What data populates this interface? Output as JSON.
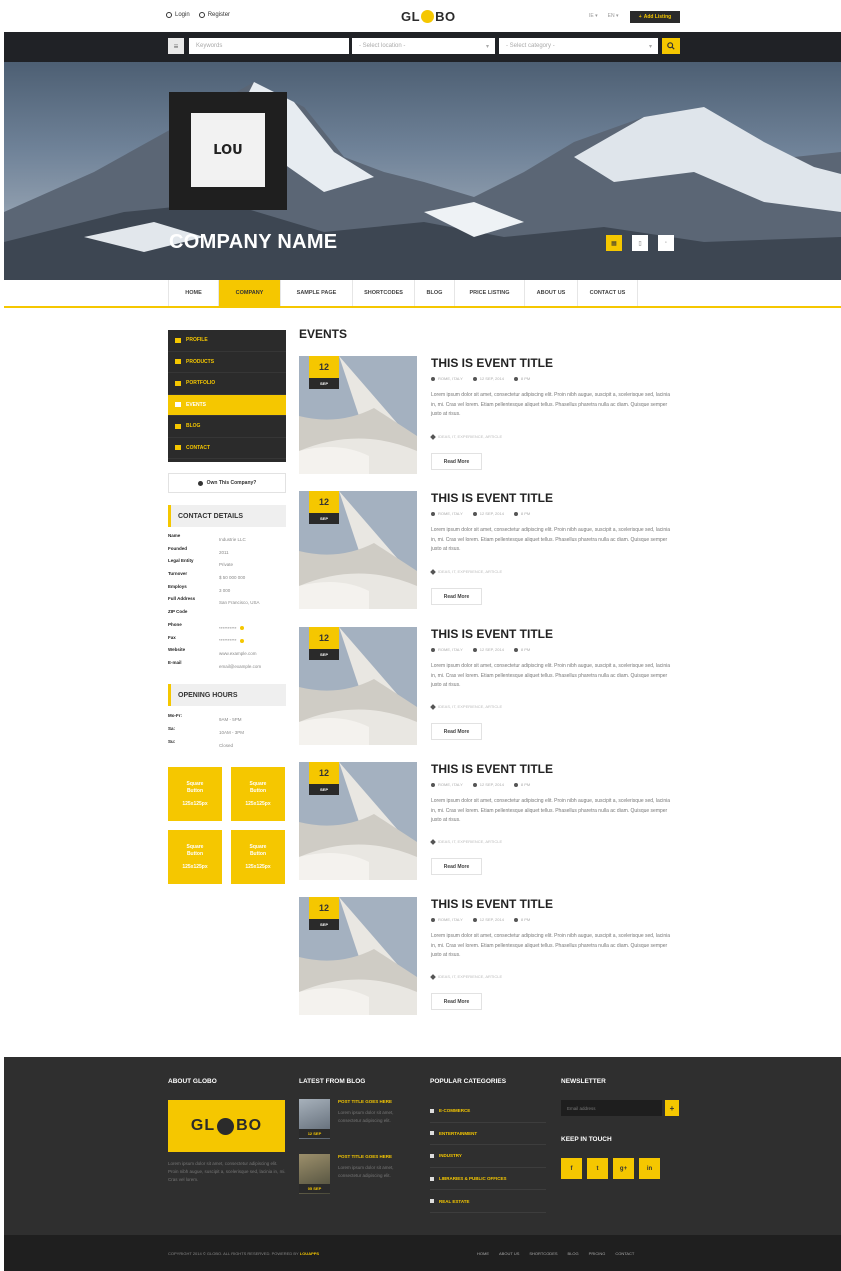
{
  "topbar": {
    "login": "Login",
    "register": "Register",
    "logo_left": "GL",
    "logo_right": "BO",
    "lang1": "IE ▾",
    "lang2": "EN ▾",
    "add_listing": "Add Listing"
  },
  "search": {
    "keywords_placeholder": "Keywords",
    "location_placeholder": "- Select location -",
    "category_placeholder": "- Select category -"
  },
  "hero": {
    "logo_mark": "LOU",
    "company_name": "COMPANY NAME"
  },
  "nav": [
    {
      "label": "HOME",
      "active": false
    },
    {
      "label": "COMPANY",
      "active": true
    },
    {
      "label": "SAMPLE PAGE",
      "active": false
    },
    {
      "label": "SHORTCODES",
      "active": false
    },
    {
      "label": "BLOG",
      "active": false
    },
    {
      "label": "PRICE LISTING",
      "active": false
    },
    {
      "label": "ABOUT US",
      "active": false
    },
    {
      "label": "CONTACT US",
      "active": false
    }
  ],
  "sidebar": {
    "menu": [
      {
        "label": "PROFILE",
        "icon": "profile-icon",
        "active": false
      },
      {
        "label": "PRODUCTS",
        "icon": "products-icon",
        "active": false
      },
      {
        "label": "PORTFOLIO",
        "icon": "portfolio-icon",
        "active": false
      },
      {
        "label": "EVENTS",
        "icon": "events-icon",
        "active": true
      },
      {
        "label": "BLOG",
        "icon": "blog-icon",
        "active": false
      },
      {
        "label": "CONTACT",
        "icon": "contact-icon",
        "active": false
      }
    ],
    "own_company": "Own This Company?",
    "contact_title": "CONTACT DETAILS",
    "details": [
      {
        "k": "Name",
        "v": "Industrie LLC"
      },
      {
        "k": "Founded",
        "v": "2011"
      },
      {
        "k": "Legal Entity",
        "v": "Private"
      },
      {
        "k": "Turnover",
        "v": "$ 50 000 000"
      },
      {
        "k": "Employs",
        "v": "3 000"
      },
      {
        "k": "Full Address",
        "v": "San Francisco, USA"
      },
      {
        "k": "ZIP Code",
        "v": ""
      },
      {
        "k": "Phone",
        "v": "**********"
      },
      {
        "k": "Fax",
        "v": "**********"
      },
      {
        "k": "Website",
        "v": "www.example.com"
      },
      {
        "k": "E-mail",
        "v": "email@example.com"
      }
    ],
    "hours_title": "OPENING HOURS",
    "hours": [
      {
        "k": "Mo-Fr:",
        "v": "9AM - 5PM"
      },
      {
        "k": "Sa:",
        "v": "10AM - 3PM"
      },
      {
        "k": "Su:",
        "v": "Closed"
      }
    ],
    "square_buttons": [
      {
        "line1": "Square",
        "line2": "Button",
        "size": "125x125px"
      },
      {
        "line1": "Square",
        "line2": "Button",
        "size": "125x125px"
      },
      {
        "line1": "Square",
        "line2": "Button",
        "size": "125x125px"
      },
      {
        "line1": "Square",
        "line2": "Button",
        "size": "125x125px"
      }
    ]
  },
  "events": {
    "heading": "EVENTS",
    "items": [
      {
        "day": "12",
        "month": "SEP",
        "title": "THIS IS EVENT TITLE",
        "location": "ROME, ITALY",
        "date": "12 SEP, 2014",
        "time": "8 PM",
        "text": "Lorem ipsum dolor sit amet, consectetur adipiscing elit. Proin nibh augue, suscipit a, scelerisque sed, lacinia in, mi. Cras vel lorem. Etiam pellentesque aliquet tellus. Phasellus pharetra nulla ac diam. Quisque semper justo at risus.",
        "tags": "IDEAS, IT, EXPERIENCE, ARTICLE",
        "read_more": "Read More"
      },
      {
        "day": "12",
        "month": "SEP",
        "title": "THIS IS EVENT TITLE",
        "location": "ROME, ITALY",
        "date": "12 SEP, 2014",
        "time": "8 PM",
        "text": "Lorem ipsum dolor sit amet, consectetur adipiscing elit. Proin nibh augue, suscipit a, scelerisque sed, lacinia in, mi. Cras vel lorem. Etiam pellentesque aliquet tellus. Phasellus pharetra nulla ac diam. Quisque semper justo at risus.",
        "tags": "IDEAS, IT, EXPERIENCE, ARTICLE",
        "read_more": "Read More"
      },
      {
        "day": "12",
        "month": "SEP",
        "title": "THIS IS EVENT TITLE",
        "location": "ROME, ITALY",
        "date": "12 SEP, 2014",
        "time": "8 PM",
        "text": "Lorem ipsum dolor sit amet, consectetur adipiscing elit. Proin nibh augue, suscipit a, scelerisque sed, lacinia in, mi. Cras vel lorem. Etiam pellentesque aliquet tellus. Phasellus pharetra nulla ac diam. Quisque semper justo at risus.",
        "tags": "IDEAS, IT, EXPERIENCE, ARTICLE",
        "read_more": "Read More"
      },
      {
        "day": "12",
        "month": "SEP",
        "title": "THIS IS EVENT TITLE",
        "location": "ROME, ITALY",
        "date": "12 SEP, 2014",
        "time": "8 PM",
        "text": "Lorem ipsum dolor sit amet, consectetur adipiscing elit. Proin nibh augue, suscipit a, scelerisque sed, lacinia in, mi. Cras vel lorem. Etiam pellentesque aliquet tellus. Phasellus pharetra nulla ac diam. Quisque semper justo at risus.",
        "tags": "IDEAS, IT, EXPERIENCE, ARTICLE",
        "read_more": "Read More"
      },
      {
        "day": "12",
        "month": "SEP",
        "title": "THIS IS EVENT TITLE",
        "location": "ROME, ITALY",
        "date": "12 SEP, 2014",
        "time": "8 PM",
        "text": "Lorem ipsum dolor sit amet, consectetur adipiscing elit. Proin nibh augue, suscipit a, scelerisque sed, lacinia in, mi. Cras vel lorem. Etiam pellentesque aliquet tellus. Phasellus pharetra nulla ac diam. Quisque semper justo at risus.",
        "tags": "IDEAS, IT, EXPERIENCE, ARTICLE",
        "read_more": "Read More"
      }
    ]
  },
  "footer": {
    "about_title": "ABOUT GLOBO",
    "about_text": "Lorem ipsum dolor sit amet, consectetur adipiscing elit. Proin nibh augue, suscipit a, scelerisque sed, lacinia in, mi. Cras vel lorem.",
    "blog_title": "LATEST FROM BLOG",
    "posts": [
      {
        "date": "12 SEP",
        "title": "POST TITLE GOES HERE",
        "text": "Lorem ipsum dolor sit amet, consectetur adipiscing elit."
      },
      {
        "date": "05 SEP",
        "title": "POST TITLE GOES HERE",
        "text": "Lorem ipsum dolor sit amet, consectetur adipiscing elit."
      }
    ],
    "categories_title": "POPULAR CATEGORIES",
    "categories": [
      "E-COMMERCE",
      "ENTERTAINMENT",
      "INDUSTRY",
      "LIBRARIES & PUBLIC OFFICES",
      "REAL ESTATE"
    ],
    "newsletter_title": "NEWSLETTER",
    "email_placeholder": "Email address",
    "keep_in_touch": "KEEP IN TOUCH",
    "social": [
      "f",
      "t",
      "g+",
      "in"
    ],
    "copyright_prefix": "COPYRIGHT 2014 © GLOBO. ALL RIGHTS RESERVED. POWERED BY",
    "copyright_brand": "LOUAPPS",
    "links": [
      "HOME",
      "ABOUT US",
      "SHORTCODES",
      "BLOG",
      "PRICING",
      "CONTACT"
    ]
  },
  "colors": {
    "accent": "#f5c700",
    "dark": "#2b2b2b",
    "footer": "#2f2f2f"
  }
}
